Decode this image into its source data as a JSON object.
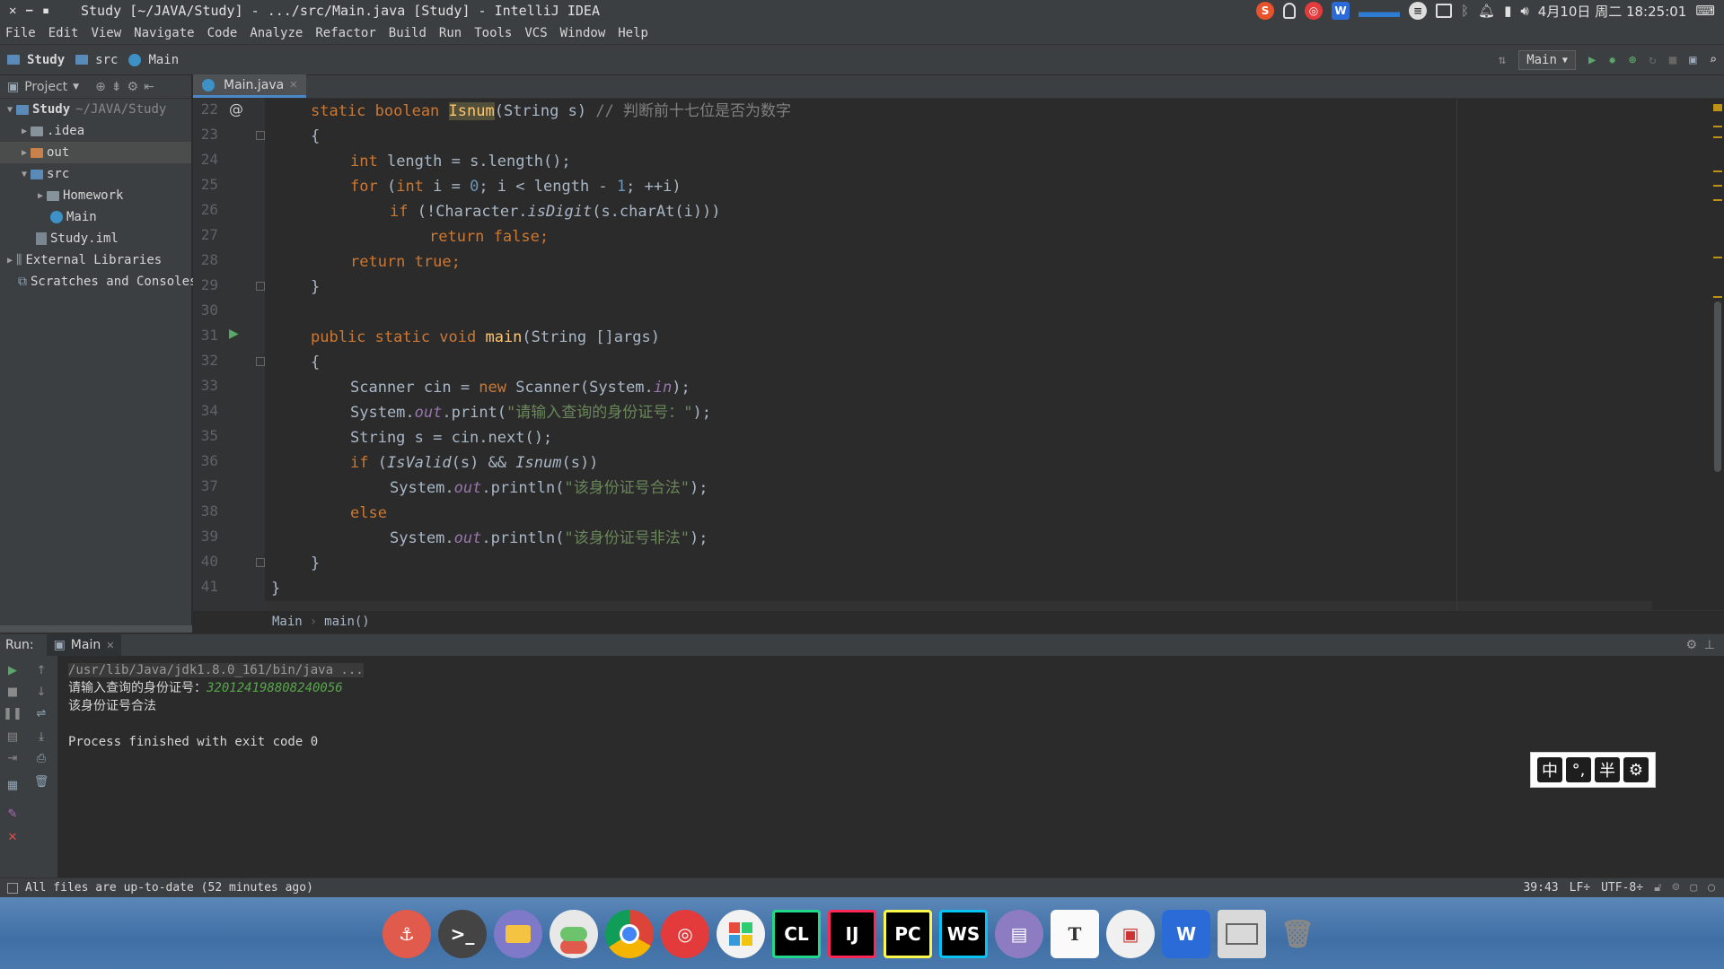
{
  "titlebar": {
    "title": "Study [~/JAVA/Study] - .../src/Main.java [Study] - IntelliJ IDEA",
    "date": "4月10日 周二 18:25:01"
  },
  "menu": [
    "File",
    "Edit",
    "View",
    "Navigate",
    "Code",
    "Analyze",
    "Refactor",
    "Build",
    "Run",
    "Tools",
    "VCS",
    "Window",
    "Help"
  ],
  "nav": {
    "crumbs": [
      "Study",
      "src",
      "Main"
    ],
    "run_config": "Main"
  },
  "project": {
    "header": "Project",
    "tree": [
      {
        "label": "Study",
        "suffix": "~/JAVA/Study"
      },
      {
        "label": ".idea"
      },
      {
        "label": "out"
      },
      {
        "label": "src"
      },
      {
        "label": "Homework"
      },
      {
        "label": "Main"
      },
      {
        "label": "Study.iml"
      },
      {
        "label": "External Libraries"
      },
      {
        "label": "Scratches and Consoles"
      }
    ]
  },
  "editor": {
    "tab": "Main.java",
    "lines": [
      "22",
      "23",
      "24",
      "25",
      "26",
      "27",
      "28",
      "29",
      "30",
      "31",
      "32",
      "33",
      "34",
      "35",
      "36",
      "37",
      "38",
      "39",
      "40",
      "41"
    ],
    "code": {
      "l22": {
        "kw": "static boolean ",
        "fn": "Isnum",
        "rest": "(String s) ",
        "cmt": "// 判断前十七位是否为数字"
      },
      "l23": "{",
      "l24": {
        "kw": "int ",
        "rest": "length = s.length();"
      },
      "l25": {
        "kw1": "for ",
        "p1": "(",
        "kw2": "int ",
        "p2": "i = ",
        "n1": "0",
        "p3": "; i < length - ",
        "n2": "1",
        "p4": "; ++i)"
      },
      "l26": {
        "kw": "if ",
        "p1": "(!Character.",
        "it": "isDigit",
        "p2": "(s.charAt(i)))"
      },
      "l27": {
        "kw": "return false",
        "p": ";"
      },
      "l28": {
        "kw": "return true",
        "p": ";"
      },
      "l29": "}",
      "l31": {
        "kw": "public static void ",
        "fn": "main",
        "rest": "(String []args)"
      },
      "l32": "{",
      "l33": {
        "p1": "Scanner cin = ",
        "kw": "new ",
        "p2": "Scanner(System.",
        "fld": "in",
        "p3": ");"
      },
      "l34": {
        "p1": "System.",
        "fld": "out",
        "p2": ".print(",
        "str": "\"请输入查询的身份证号：\"",
        "p3": ");"
      },
      "l35": "String s = cin.next();",
      "l36": {
        "kw": "if ",
        "p1": "(",
        "it1": "IsValid",
        "p2": "(s) && ",
        "it2": "Isnum",
        "p3": "(s))"
      },
      "l37": {
        "p1": "System.",
        "fld": "out",
        "p2": ".println(",
        "str": "\"该身份证号合法\"",
        "p3": ");"
      },
      "l38": "else",
      "l39": {
        "p1": "System.",
        "fld": "out",
        "p2": ".println(",
        "str": "\"该身份证号非法\"",
        "p3": ");"
      },
      "l40": "}",
      "l41": "}"
    },
    "breadcrumb": [
      "Main",
      "main()"
    ]
  },
  "run": {
    "label": "Run:",
    "tab": "Main",
    "console": {
      "cmd": "/usr/lib/Java/jdk1.8.0_161/bin/java ...",
      "prompt": "请输入查询的身份证号：",
      "input": "320124198808240056",
      "result": "该身份证号合法",
      "exit": "Process finished with exit code 0"
    }
  },
  "ime": [
    "中",
    "°,",
    "半",
    "⚙"
  ],
  "status": {
    "message": "All files are up-to-date (52 minutes ago)",
    "position": "39:43",
    "line_sep": "LF÷",
    "encoding": "UTF-8÷"
  },
  "dock": [
    "⚓",
    ">_",
    "",
    "",
    "",
    "",
    "",
    "CL",
    "IJ",
    "PC",
    "WS",
    "",
    "T",
    "",
    "W",
    "",
    ""
  ]
}
